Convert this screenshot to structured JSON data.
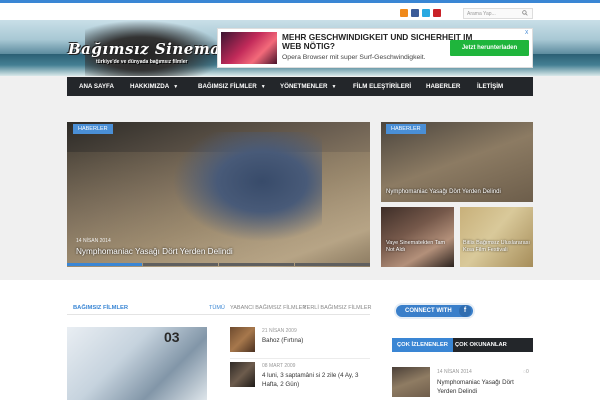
{
  "search": {
    "placeholder": "Arama Yap..."
  },
  "social": {
    "icons": [
      "rss-icon",
      "facebook-icon",
      "twitter-icon",
      "pinterest-icon"
    ],
    "colors": [
      "#f08a1c",
      "#3b5b98",
      "#29a9e1",
      "#c92228"
    ]
  },
  "site": {
    "logo": "Bağımsız Sinema",
    "tagline": "türkiye'de ve dünyada bağımsız filmler"
  },
  "ad": {
    "title": "MEHR GESCHWINDIGKEIT UND SICHERHEIT IM WEB NÖTIG?",
    "text": "Opera Browser mit super Surf-Geschwindigkeit.",
    "button": "Jetzt herunterladen",
    "close": "X"
  },
  "nav": [
    {
      "label": "ANA SAYFA",
      "dropdown": false
    },
    {
      "label": "HAKKIMIZDA",
      "dropdown": true
    },
    {
      "label": "BAĞIMSIZ FİLMLER",
      "dropdown": true
    },
    {
      "label": "YÖNETMENLER",
      "dropdown": true
    },
    {
      "label": "FİLM ELEŞTİRİLERİ",
      "dropdown": false
    },
    {
      "label": "HABERLER",
      "dropdown": false
    },
    {
      "label": "İLETİŞİM",
      "dropdown": false
    }
  ],
  "slider": {
    "tag": "HABERLER",
    "date": "14 NİSAN 2014",
    "title": "Nymphomaniac Yasağı Dört Yerden Delindi",
    "active_index": 0,
    "total": 4
  },
  "side": {
    "top": {
      "tag": "HABERLER",
      "title": "Nymphomaniac Yasağı Dört Yerden Delindi"
    },
    "left": {
      "title": "Vaye Sinematekten Tam Not Aldı"
    },
    "right": {
      "title": "Bitlis Bağımsız Uluslararası Kısa Film Festivali"
    }
  },
  "section": {
    "title": "BAĞIMSIZ FİLMLER",
    "filters": [
      "TÜMÜ",
      "YABANCI BAĞIMSIZ FİLMLER",
      "YERLİ BAĞIMSIZ FİLMLER"
    ],
    "featured_badge": "03",
    "list": [
      {
        "date": "21 NİSAN 2009",
        "title": "Bahoz (Fırtına)"
      },
      {
        "date": "08 MART 2009",
        "title": "4 luni, 3 saptamâni si 2 zile (4 Ay, 3 Hafta, 2 Gün)"
      }
    ]
  },
  "connect": {
    "label": "CONNECT WITH",
    "icon": "facebook-icon"
  },
  "popular": {
    "tabs": [
      "ÇOK İZLENENLER",
      "ÇOK OKUNANLAR"
    ],
    "item": {
      "date": "14 NİSAN 2014",
      "count": "0",
      "title": "Nymphomaniac Yasağı Dört Yerden Delindi"
    }
  }
}
